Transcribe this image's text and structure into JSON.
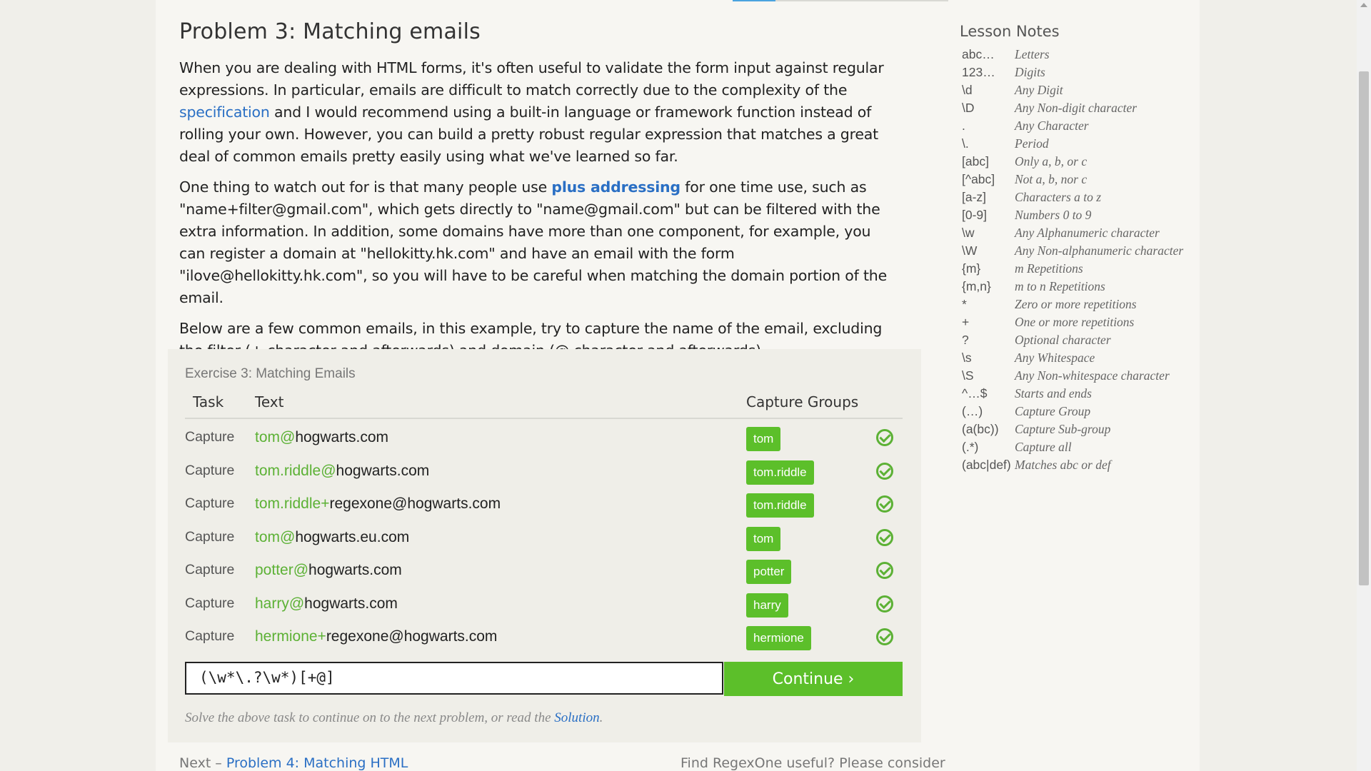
{
  "problem": {
    "title": "Problem 3: Matching emails",
    "p1_a": "When you are dealing with HTML forms, it's often useful to validate the form input against regular expressions. In particular, emails are difficult to match correctly due to the complexity of the ",
    "p1_link": "specification",
    "p1_b": " and I would recommend using a built-in language or framework function instead of rolling your own. However, you can build a pretty robust regular expression that matches a great deal of common emails pretty easily using what we've learned so far.",
    "p2_a": "One thing to watch out for is that many people use ",
    "p2_link": "plus addressing",
    "p2_b": " for one time use, such as \"name+filter@gmail.com\", which gets directly to \"name@gmail.com\" but can be filtered with the extra information. In addition, some domains have more than one component, for example, you can register a domain at \"hellokitty.hk.com\" and have an email with the form \"ilove@hellokitty.hk.com\", so you will have to be careful when matching the domain portion of the email.",
    "p3": "Below are a few common emails, in this example, try to capture the name of the email, excluding the filter (+ character and afterwards) and domain (@ character and afterwards)."
  },
  "exercise": {
    "title": "Exercise 3: Matching Emails",
    "headers": {
      "task": "Task",
      "text": "Text",
      "groups": "Capture Groups"
    },
    "rows": [
      {
        "task": "Capture",
        "matched": "tom@",
        "rest": "hogwarts.com",
        "group": "tom"
      },
      {
        "task": "Capture",
        "matched": "tom.riddle@",
        "rest": "hogwarts.com",
        "group": "tom.riddle"
      },
      {
        "task": "Capture",
        "matched": "tom.riddle+",
        "rest": "regexone@hogwarts.com",
        "group": "tom.riddle"
      },
      {
        "task": "Capture",
        "matched": "tom@",
        "rest": "hogwarts.eu.com",
        "group": "tom"
      },
      {
        "task": "Capture",
        "matched": "potter@",
        "rest": "hogwarts.com",
        "group": "potter"
      },
      {
        "task": "Capture",
        "matched": "harry@",
        "rest": "hogwarts.com",
        "group": "harry"
      },
      {
        "task": "Capture",
        "matched": "hermione+",
        "rest": "regexone@hogwarts.com",
        "group": "hermione"
      }
    ],
    "input_value": "(\\w*\\.?\\w*)[+@]",
    "continue_label": "Continue ›",
    "hint_a": "Solve the above task to continue on to the next problem, or read the ",
    "hint_link": "Solution",
    "hint_b": "."
  },
  "footer": {
    "next_prefix": "Next – ",
    "next_link": "Problem 4: Matching HTML",
    "right_text": "Find RegexOne useful? Please consider"
  },
  "notes": {
    "title": "Lesson Notes",
    "items": [
      {
        "k": "abc…",
        "v": "Letters"
      },
      {
        "k": "123…",
        "v": "Digits"
      },
      {
        "k": "\\d",
        "v": "Any Digit"
      },
      {
        "k": "\\D",
        "v": "Any Non-digit character"
      },
      {
        "k": ".",
        "v": "Any Character"
      },
      {
        "k": "\\.",
        "v": "Period"
      },
      {
        "k": "[abc]",
        "v": "Only a, b, or c"
      },
      {
        "k": "[^abc]",
        "v": "Not a, b, nor c"
      },
      {
        "k": "[a-z]",
        "v": "Characters a to z"
      },
      {
        "k": "[0-9]",
        "v": "Numbers 0 to 9"
      },
      {
        "k": "\\w",
        "v": "Any Alphanumeric character"
      },
      {
        "k": "\\W",
        "v": "Any Non-alphanumeric character"
      },
      {
        "k": "{m}",
        "v": "m Repetitions"
      },
      {
        "k": "{m,n}",
        "v": "m to n Repetitions"
      },
      {
        "k": "*",
        "v": "Zero or more repetitions"
      },
      {
        "k": "+",
        "v": "One or more repetitions"
      },
      {
        "k": "?",
        "v": "Optional character"
      },
      {
        "k": "\\s",
        "v": "Any Whitespace"
      },
      {
        "k": "\\S",
        "v": "Any Non-whitespace character"
      },
      {
        "k": "^…$",
        "v": "Starts and ends"
      },
      {
        "k": "(…)",
        "v": "Capture Group"
      },
      {
        "k": "(a(bc))",
        "v": "Capture Sub-group"
      },
      {
        "k": "(.*)",
        "v": "Capture all"
      },
      {
        "k": "(abc|def)",
        "v": "Matches abc or def"
      }
    ]
  }
}
